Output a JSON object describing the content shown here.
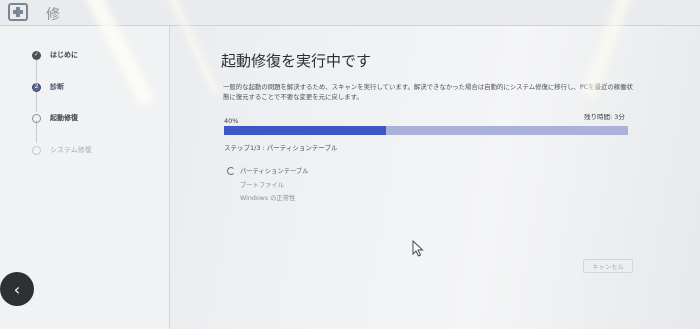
{
  "window": {
    "title": "修",
    "app_icon": "medical-cross-icon"
  },
  "sidebar": {
    "steps": [
      {
        "label": "はじめに",
        "status": "done"
      },
      {
        "label": "診断",
        "status": "current"
      },
      {
        "label": "起動修復",
        "status": "pending"
      },
      {
        "label": "システム修復",
        "status": "pending"
      }
    ]
  },
  "main": {
    "heading": "起動修復を実行中です",
    "description": "一般的な起動の問題を解決するため、スキャンを実行しています。解決できなかった場合は自動的にシステム修復に移行し、PCを最近の稼働状態に復元することで不要な変更を元に戻します。",
    "progress_label": "40%",
    "progress_value": 0.4,
    "time_remaining": "残り時間: 3分",
    "step_status": "ステップ1/3 : パーティションテーブル",
    "tasks": [
      {
        "label": "パーティションテーブル",
        "state": "running"
      },
      {
        "label": "ブートファイル",
        "state": "pending"
      },
      {
        "label": "Windows の正常性",
        "state": "pending"
      }
    ],
    "cancel_label": "キャンセル"
  },
  "nav": {
    "back_icon": "chevron-left-icon",
    "back_glyph": "‹"
  },
  "colors": {
    "progress_fill": "#3f57c4",
    "progress_track": "#aab2d9"
  }
}
